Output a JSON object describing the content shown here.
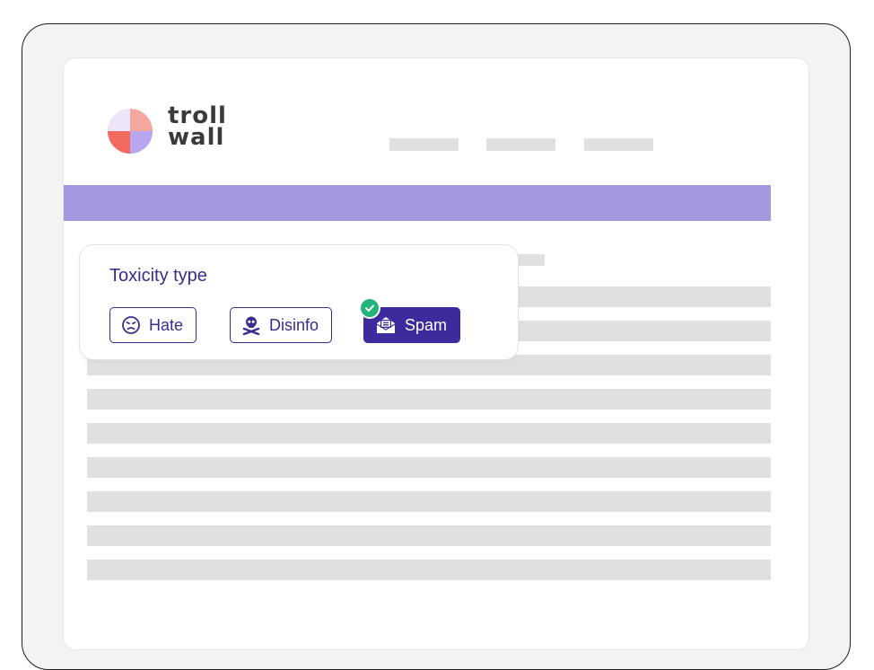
{
  "brand": {
    "logo_text_line1": "troll",
    "logo_text_line2": "wall"
  },
  "toxicity_card": {
    "title": "Toxicity type",
    "options": [
      {
        "label": "Hate",
        "icon": "angry-face-icon",
        "selected": false
      },
      {
        "label": "Disinfo",
        "icon": "skull-crossbones-icon",
        "selected": false
      },
      {
        "label": "Spam",
        "icon": "envelope-icon",
        "selected": true
      }
    ]
  },
  "colors": {
    "accent_purple": "#3d2a9c",
    "band_purple": "#a498de",
    "check_green": "#26b47d",
    "logo_red": "#f26a5d",
    "logo_pink": "#f4a79e",
    "logo_lavender": "#b8a7ef"
  }
}
